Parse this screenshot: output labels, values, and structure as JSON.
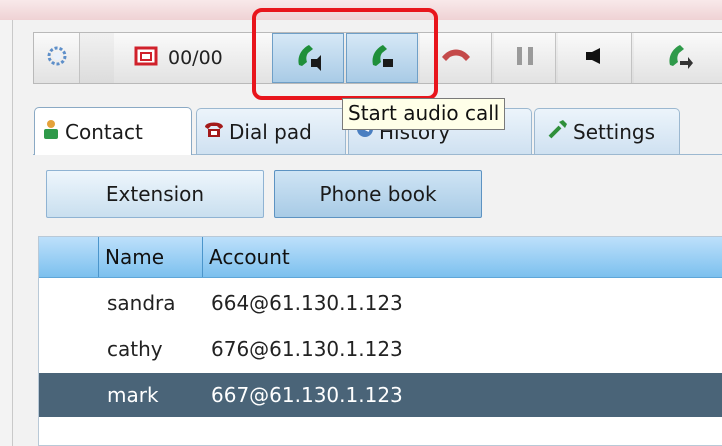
{
  "toolbar": {
    "counter_text": "00/00",
    "buttons": [
      {
        "name": "status-button",
        "icon": "spinner-icon"
      },
      {
        "name": "voicemail-button",
        "icon": "voicemail-icon"
      },
      {
        "name": "start-audio-call-button",
        "icon": "phone-audio-icon"
      },
      {
        "name": "start-video-call-button",
        "icon": "phone-video-icon"
      },
      {
        "name": "hang-up-button",
        "icon": "hangup-icon"
      },
      {
        "name": "hold-button",
        "icon": "pause-icon"
      },
      {
        "name": "mute-button",
        "icon": "speaker-icon"
      },
      {
        "name": "transfer-button",
        "icon": "phone-transfer-icon"
      }
    ]
  },
  "tooltip": {
    "text": "Start audio call"
  },
  "tabs": [
    {
      "label": "Contact",
      "icon": "contact-icon",
      "active": true
    },
    {
      "label": "Dial pad",
      "icon": "dialpad-icon"
    },
    {
      "label": "History",
      "icon": "history-icon"
    },
    {
      "label": "Settings",
      "icon": "settings-icon"
    }
  ],
  "subtabs": [
    {
      "label": "Extension"
    },
    {
      "label": "Phone book",
      "active": true
    }
  ],
  "table": {
    "columns": [
      "Name",
      "Account"
    ],
    "rows": [
      {
        "name": "sandra",
        "account": "664@61.130.1.123"
      },
      {
        "name": "cathy",
        "account": "676@61.130.1.123"
      },
      {
        "name": "mark",
        "account": "667@61.130.1.123",
        "selected": true
      }
    ]
  },
  "colors": {
    "highlight": "#e8151c",
    "phone_green": "#1f8f3a",
    "hangup_red": "#c44a4a",
    "header_blue": "#7cc0ee",
    "selected_row": "#4a6478"
  }
}
